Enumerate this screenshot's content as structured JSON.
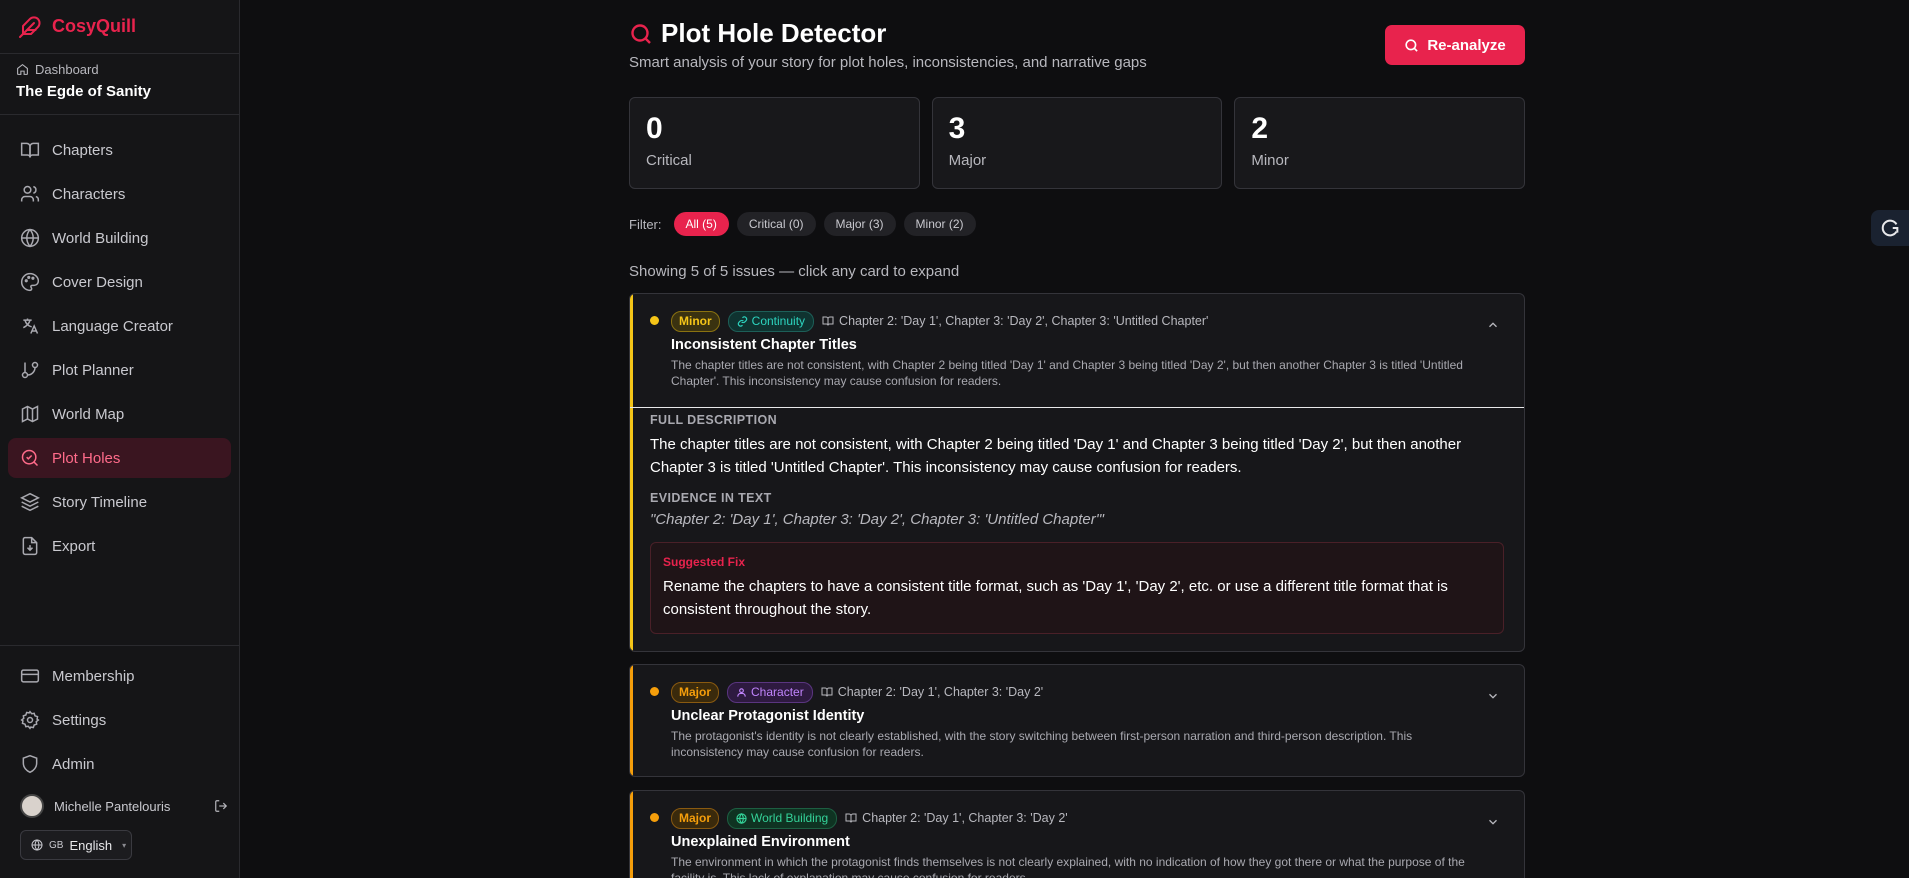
{
  "brand": {
    "name": "CosyQuill",
    "color": "#e8234d"
  },
  "project": {
    "breadcrumb": "Dashboard",
    "title": "The Egde of Sanity"
  },
  "nav": [
    {
      "label": "Chapters",
      "icon": "book-open-icon",
      "active": false
    },
    {
      "label": "Characters",
      "icon": "users-icon",
      "active": false
    },
    {
      "label": "World Building",
      "icon": "globe-icon",
      "active": false
    },
    {
      "label": "Cover Design",
      "icon": "palette-icon",
      "active": false
    },
    {
      "label": "Language Creator",
      "icon": "languages-icon",
      "active": false
    },
    {
      "label": "Plot Planner",
      "icon": "git-branch-icon",
      "active": false
    },
    {
      "label": "World Map",
      "icon": "map-icon",
      "active": false
    },
    {
      "label": "Plot Holes",
      "icon": "search-check-icon",
      "active": true
    },
    {
      "label": "Story Timeline",
      "icon": "layers-icon",
      "active": false
    },
    {
      "label": "Export",
      "icon": "file-download-icon",
      "active": false
    }
  ],
  "bottom_nav": [
    {
      "label": "Membership",
      "icon": "credit-card-icon"
    },
    {
      "label": "Settings",
      "icon": "gear-icon"
    },
    {
      "label": "Admin",
      "icon": "shield-icon"
    }
  ],
  "user": {
    "name": "Michelle Pantelouris"
  },
  "language": {
    "flag": "GB",
    "label": "English"
  },
  "header": {
    "title": "Plot Hole Detector",
    "subtitle": "Smart analysis of your story for plot holes, inconsistencies, and narrative gaps",
    "reanalyze_label": "Re-analyze"
  },
  "stats": [
    {
      "value": "0",
      "label": "Critical"
    },
    {
      "value": "3",
      "label": "Major"
    },
    {
      "value": "2",
      "label": "Minor"
    }
  ],
  "filter": {
    "label": "Filter:",
    "chips": [
      {
        "label": "All (5)",
        "active": true
      },
      {
        "label": "Critical (0)",
        "active": false
      },
      {
        "label": "Major (3)",
        "active": false
      },
      {
        "label": "Minor (2)",
        "active": false
      }
    ]
  },
  "showing_text": "Showing 5 of 5 issues — click any card to expand",
  "issues": [
    {
      "severity": "Minor",
      "category": "Continuity",
      "location": "Chapter 2: 'Day 1', Chapter 3: 'Day 2', Chapter 3: 'Untitled Chapter'",
      "title": "Inconsistent Chapter Titles",
      "summary": "The chapter titles are not consistent, with Chapter 2 being titled 'Day 1' and Chapter 3 being titled 'Day 2', but then another Chapter 3 is titled 'Untitled Chapter'. This inconsistency may cause confusion for readers.",
      "expanded": true,
      "full_description_heading": "FULL DESCRIPTION",
      "full_description": "The chapter titles are not consistent, with Chapter 2 being titled 'Day 1' and Chapter 3 being titled 'Day 2', but then another Chapter 3 is titled 'Untitled Chapter'. This inconsistency may cause confusion for readers.",
      "evidence_heading": "EVIDENCE IN TEXT",
      "evidence": "\"Chapter 2: 'Day 1', Chapter 3: 'Day 2', Chapter 3: 'Untitled Chapter'\"",
      "fix_heading": "Suggested Fix",
      "fix": "Rename the chapters to have a consistent title format, such as 'Day 1', 'Day 2', etc. or use a different title format that is consistent throughout the story."
    },
    {
      "severity": "Major",
      "category": "Character",
      "location": "Chapter 2: 'Day 1', Chapter 3: 'Day 2'",
      "title": "Unclear Protagonist Identity",
      "summary": "The protagonist's identity is not clearly established, with the story switching between first-person narration and third-person description. This inconsistency may cause confusion for readers.",
      "expanded": false
    },
    {
      "severity": "Major",
      "category": "World Building",
      "location": "Chapter 2: 'Day 1', Chapter 3: 'Day 2'",
      "title": "Unexplained Environment",
      "summary": "The environment in which the protagonist finds themselves is not clearly explained, with no indication of how they got there or what the purpose of the facility is. This lack of explanation may cause confusion for readers.",
      "expanded": false
    }
  ],
  "colors": {
    "minor": "#f5c518",
    "major": "#f59e0b",
    "continuity": "#2dd4bf",
    "character": "#c084fc",
    "world_building": "#34d399",
    "accent": "#e8234d"
  }
}
